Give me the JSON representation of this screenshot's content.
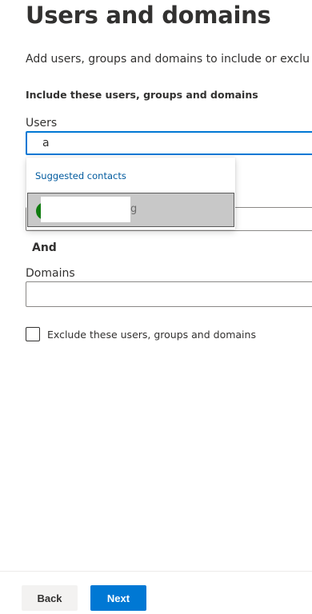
{
  "page": {
    "title": "Users and domains",
    "description": "Add users, groups and domains to include or exclu",
    "section_heading": "Include these users, groups and domains"
  },
  "users": {
    "label": "Users",
    "typed_value": "a"
  },
  "suggestions": {
    "header": "Suggested contacts",
    "items": [
      {
        "name_tail": "g",
        "avatar_color": "#107c10"
      }
    ]
  },
  "groups": {
    "value": ""
  },
  "and_label": "And",
  "domains": {
    "label": "Domains",
    "value": ""
  },
  "exclude": {
    "label": "Exclude these users, groups and domains",
    "checked": false
  },
  "footer": {
    "back_label": "Back",
    "next_label": "Next"
  },
  "colors": {
    "accent": "#0078d4",
    "link": "#005a9e",
    "avatar": "#107c10",
    "selected_row": "#c8c8c8"
  }
}
